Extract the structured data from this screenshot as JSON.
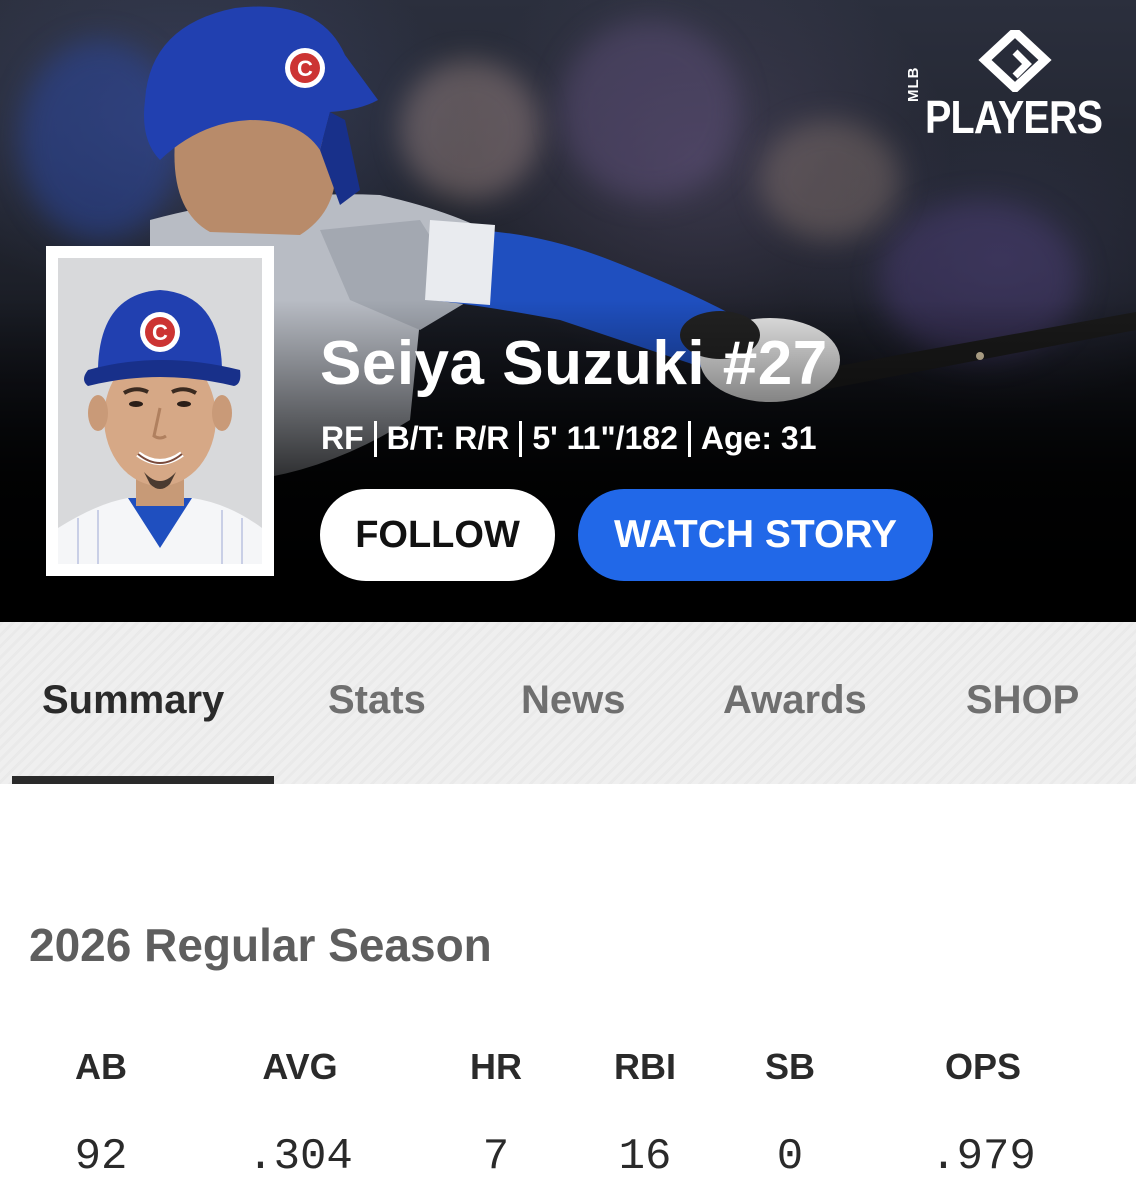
{
  "branding": {
    "logo_top": "MLB",
    "logo_text": "PLAYERS"
  },
  "player": {
    "name": "Seiya Suzuki #27",
    "position": "RF",
    "bats_throws": "B/T: R/R",
    "height_weight": "5' 11\"/182",
    "age": "Age: 31"
  },
  "actions": {
    "follow_label": "FOLLOW",
    "watch_label": "WATCH STORY"
  },
  "tabs": [
    {
      "label": "Summary",
      "active": true
    },
    {
      "label": "Stats",
      "active": false
    },
    {
      "label": "News",
      "active": false
    },
    {
      "label": "Awards",
      "active": false
    },
    {
      "label": "SHOP",
      "active": false
    }
  ],
  "season": {
    "title": "2026 Regular Season",
    "stats": [
      {
        "label": "AB",
        "value": "92"
      },
      {
        "label": "AVG",
        "value": ".304"
      },
      {
        "label": "HR",
        "value": "7"
      },
      {
        "label": "RBI",
        "value": "16"
      },
      {
        "label": "SB",
        "value": "0"
      },
      {
        "label": "OPS",
        "value": ".979"
      }
    ]
  },
  "colors": {
    "accent_blue": "#2168e8",
    "cubs_blue": "#1f4fbf",
    "cubs_red": "#cc3433"
  }
}
